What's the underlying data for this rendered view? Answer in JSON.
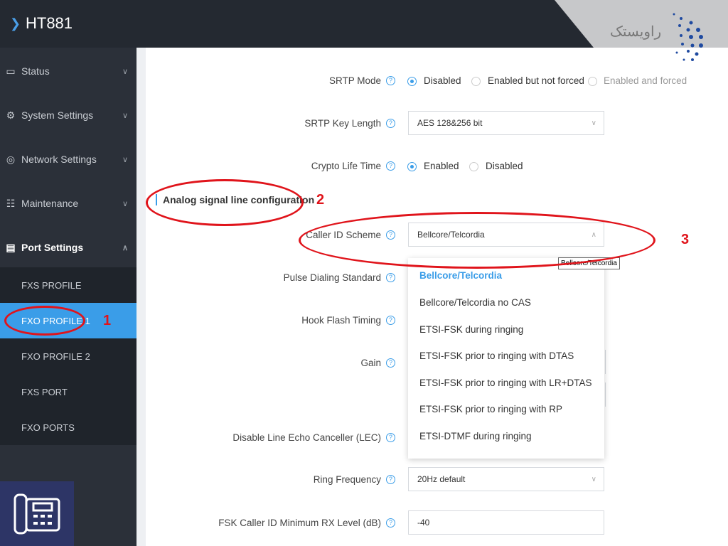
{
  "header": {
    "title": "HT881",
    "watermark_text": "راویستک"
  },
  "sidebar": {
    "items": [
      {
        "label": "Status",
        "icon": "monitor-icon"
      },
      {
        "label": "System Settings",
        "icon": "gear-icon"
      },
      {
        "label": "Network Settings",
        "icon": "globe-icon"
      },
      {
        "label": "Maintenance",
        "icon": "grid-icon"
      },
      {
        "label": "Port Settings",
        "icon": "port-icon",
        "expanded": true
      }
    ],
    "subitems": [
      {
        "label": "FXS PROFILE"
      },
      {
        "label": "FXO PROFILE 1",
        "active": true
      },
      {
        "label": "FXO PROFILE 2"
      },
      {
        "label": "FXS PORT"
      },
      {
        "label": "FXO PORTS"
      }
    ]
  },
  "form": {
    "srtp_mode": {
      "label": "SRTP Mode",
      "options": [
        "Disabled",
        "Enabled but not forced",
        "Enabled and forced"
      ],
      "selected": "Disabled"
    },
    "srtp_key_length": {
      "label": "SRTP Key Length",
      "value": "AES 128&256 bit"
    },
    "crypto_life_time": {
      "label": "Crypto Life Time",
      "options": [
        "Enabled",
        "Disabled"
      ],
      "selected": "Enabled"
    },
    "section_title": "Analog signal line configuration",
    "caller_id_scheme": {
      "label": "Caller ID Scheme",
      "value": "Bellcore/Telcordia",
      "tooltip": "Bellcore/Telcordia",
      "options": [
        "Bellcore/Telcordia",
        "Bellcore/Telcordia no CAS",
        "ETSI-FSK during ringing",
        "ETSI-FSK prior to ringing with DTAS",
        "ETSI-FSK prior to ringing with LR+DTAS",
        "ETSI-FSK prior to ringing with RP",
        "ETSI-DTMF during ringing"
      ]
    },
    "pulse_dialing": {
      "label": "Pulse Dialing Standard"
    },
    "hook_flash": {
      "label": "Hook Flash Timing"
    },
    "gain": {
      "label": "Gain"
    },
    "lec": {
      "label": "Disable Line Echo Canceller (LEC)"
    },
    "ring_frequency": {
      "label": "Ring Frequency",
      "value": "20Hz default"
    },
    "fsk_min_rx": {
      "label": "FSK Caller ID Minimum RX Level (dB)",
      "value": "-40"
    }
  },
  "annotations": {
    "n1": "1",
    "n2": "2",
    "n3": "3",
    "color": "#e0141b"
  }
}
